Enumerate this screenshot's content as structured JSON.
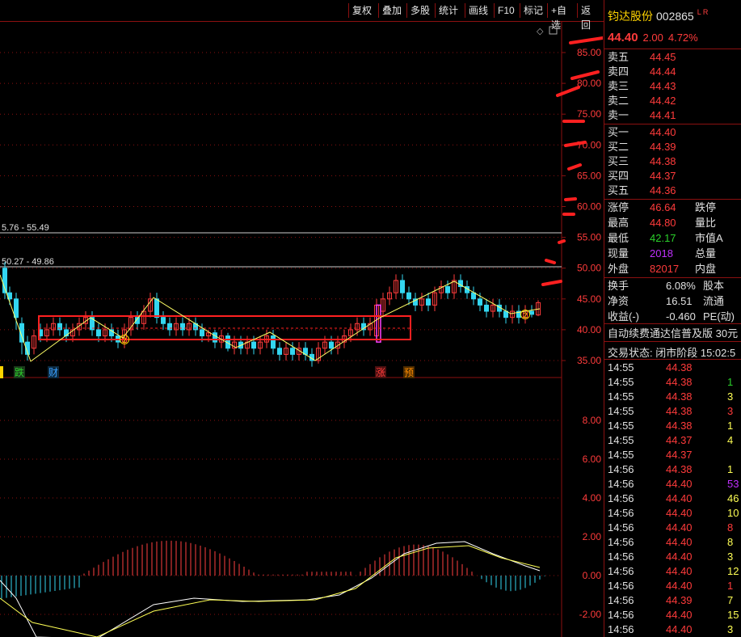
{
  "toolbar": {
    "buttons": [
      "复权",
      "叠加",
      "多股",
      "统计",
      "画线",
      "F10",
      "标记",
      "+自选",
      "返回"
    ]
  },
  "chart": {
    "price_axis": [
      "85.00",
      "80.00",
      "75.00",
      "70.00",
      "65.00",
      "60.00",
      "55.00",
      "50.00",
      "45.00",
      "40.00",
      "35.00"
    ],
    "macd_axis": [
      "8.00",
      "6.00",
      "4.00",
      "2.00",
      "0.00",
      "-2.00"
    ],
    "level_labels": [
      "5.76 - 55.49",
      "50.27 - 49.86"
    ],
    "event_markers": [
      {
        "text": "跌",
        "color": "#2bd12b"
      },
      {
        "text": "财",
        "color": "#3aa0ff"
      },
      {
        "text": "涨",
        "color": "#ff3b3b"
      },
      {
        "text": "预",
        "color": "#ff8c00"
      }
    ],
    "circle_marks": [
      "2",
      "2"
    ],
    "colors": {
      "up": "#ff3b3b",
      "down": "#33d6f0",
      "zigzag": "#ffff66",
      "box": "#ff2020",
      "grid": "#8b1010"
    }
  },
  "quote": {
    "name": "钧达股份",
    "code": "002865",
    "flags": "L R",
    "price": "44.40",
    "change": "2.00",
    "pct": "4.72%",
    "sells": [
      {
        "label": "卖五",
        "price": "44.45"
      },
      {
        "label": "卖四",
        "price": "44.44"
      },
      {
        "label": "卖三",
        "price": "44.43"
      },
      {
        "label": "卖二",
        "price": "44.42"
      },
      {
        "label": "卖一",
        "price": "44.41"
      }
    ],
    "buys": [
      {
        "label": "买一",
        "price": "44.40"
      },
      {
        "label": "买二",
        "price": "44.39"
      },
      {
        "label": "买三",
        "price": "44.38"
      },
      {
        "label": "买四",
        "price": "44.37"
      },
      {
        "label": "买五",
        "price": "44.36"
      }
    ],
    "stats": [
      {
        "l": "涨停",
        "v": "46.64",
        "c": "red",
        "l2": "跌停"
      },
      {
        "l": "最高",
        "v": "44.80",
        "c": "red",
        "l2": "量比"
      },
      {
        "l": "最低",
        "v": "42.17",
        "c": "green",
        "l2": "市值A"
      },
      {
        "l": "现量",
        "v": "2018",
        "c": "purple",
        "l2": "总量"
      },
      {
        "l": "外盘",
        "v": "82017",
        "c": "red",
        "l2": "内盘"
      }
    ],
    "stats2": [
      {
        "l": "换手",
        "v": "6.08%",
        "l2": "股本"
      },
      {
        "l": "净资",
        "v": "16.51",
        "l2": "流通"
      },
      {
        "l": "收益(-)",
        "v": "-0.460",
        "l2": "PE(动)"
      }
    ],
    "ticker": "自动续费通达信普及版 30元",
    "status": "交易状态: 闭市阶段 15:02:5",
    "trades": [
      {
        "t": "14:55",
        "p": "44.38",
        "v": ""
      },
      {
        "t": "14:55",
        "p": "44.38",
        "v": "1"
      },
      {
        "t": "14:55",
        "p": "44.38",
        "v": "3"
      },
      {
        "t": "14:55",
        "p": "44.38",
        "v": "3"
      },
      {
        "t": "14:55",
        "p": "44.38",
        "v": "1"
      },
      {
        "t": "14:55",
        "p": "44.37",
        "v": "4"
      },
      {
        "t": "14:55",
        "p": "44.37",
        "v": ""
      },
      {
        "t": "14:56",
        "p": "44.38",
        "v": "1"
      },
      {
        "t": "14:56",
        "p": "44.40",
        "v": "53"
      },
      {
        "t": "14:56",
        "p": "44.40",
        "v": "46"
      },
      {
        "t": "14:56",
        "p": "44.40",
        "v": "10"
      },
      {
        "t": "14:56",
        "p": "44.40",
        "v": "8"
      },
      {
        "t": "14:56",
        "p": "44.40",
        "v": "8"
      },
      {
        "t": "14:56",
        "p": "44.40",
        "v": "3"
      },
      {
        "t": "14:56",
        "p": "44.40",
        "v": "12"
      },
      {
        "t": "14:56",
        "p": "44.40",
        "v": "1"
      },
      {
        "t": "14:56",
        "p": "44.39",
        "v": "7"
      },
      {
        "t": "14:56",
        "p": "44.40",
        "v": "15"
      },
      {
        "t": "14:56",
        "p": "44.40",
        "v": "3"
      }
    ]
  }
}
